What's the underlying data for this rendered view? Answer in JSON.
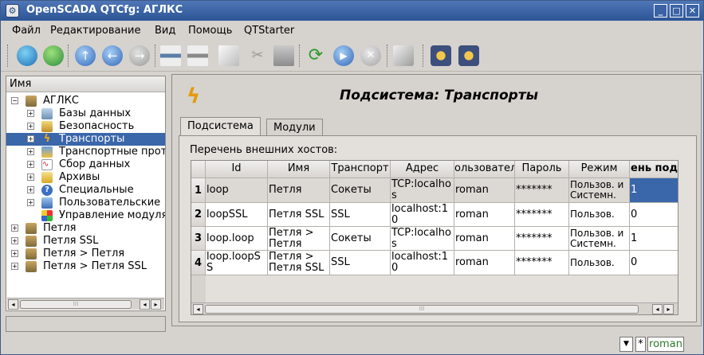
{
  "window": {
    "title": "OpenSCADA QTCfg: АГЛКС",
    "app_icon": "openscada-icon"
  },
  "menu": [
    "Файл",
    "Редактирование",
    "Вид",
    "Помощь",
    "QTStarter"
  ],
  "tree": {
    "header": "Имя",
    "items": [
      {
        "label": "АГЛКС",
        "icon": "station-icon"
      },
      {
        "label": "Базы данных",
        "icon": "database-icon"
      },
      {
        "label": "Безопасность",
        "icon": "security-icon"
      },
      {
        "label": "Транспорты",
        "icon": "lightning-icon"
      },
      {
        "label": "Транспортные прот",
        "icon": "protocol-icon"
      },
      {
        "label": "Сбор данных",
        "icon": "data-acquisition-icon"
      },
      {
        "label": "Архивы",
        "icon": "archive-icon"
      },
      {
        "label": "Специальные",
        "icon": "help-icon"
      },
      {
        "label": "Пользовательские",
        "icon": "user-interface-icon"
      },
      {
        "label": "Управление модуля",
        "icon": "module-icon"
      },
      {
        "label": "Петля",
        "icon": "station-icon"
      },
      {
        "label": "Петля SSL",
        "icon": "station-icon"
      },
      {
        "label": "Петля > Петля",
        "icon": "station-icon"
      },
      {
        "label": "Петля > Петля SSL",
        "icon": "station-icon"
      }
    ]
  },
  "page": {
    "title": "Подсистема: Транспорты",
    "icon": "lightning-icon"
  },
  "tabs": [
    "Подсистема",
    "Модули"
  ],
  "table": {
    "label": "Перечень внешних хостов:",
    "columns": [
      "Id",
      "Имя",
      "Транспорт",
      "Адрес",
      "Пользователь",
      "Пароль",
      "Режим",
      "Уровень поддержки"
    ],
    "column_visible": [
      "Id",
      "Имя",
      "Транспорт",
      "Адрес",
      "ользовател",
      "Пароль",
      "Режим",
      "ень под"
    ],
    "rows": [
      {
        "num": "1",
        "cells": [
          "loop",
          "Петля",
          "Сокеты",
          "TCP:localhos",
          "roman",
          "*******",
          "Пользов. и Системн.",
          "1"
        ]
      },
      {
        "num": "2",
        "cells": [
          "loopSSL",
          "Петля SSL",
          "SSL",
          "localhost:10",
          "roman",
          "*******",
          "Пользов.",
          "0"
        ]
      },
      {
        "num": "3",
        "cells": [
          "loop.loop",
          "Петля > Петля",
          "Сокеты",
          "TCP:localhos",
          "roman",
          "*******",
          "Пользов. и Системн.",
          "1"
        ]
      },
      {
        "num": "4",
        "cells": [
          "loop.loopSS",
          "Петля > Петля SSL",
          "SSL",
          "localhost:10",
          "roman",
          "*******",
          "Пользов.",
          "0"
        ]
      }
    ]
  },
  "status": {
    "user": "roman",
    "star": "*"
  }
}
